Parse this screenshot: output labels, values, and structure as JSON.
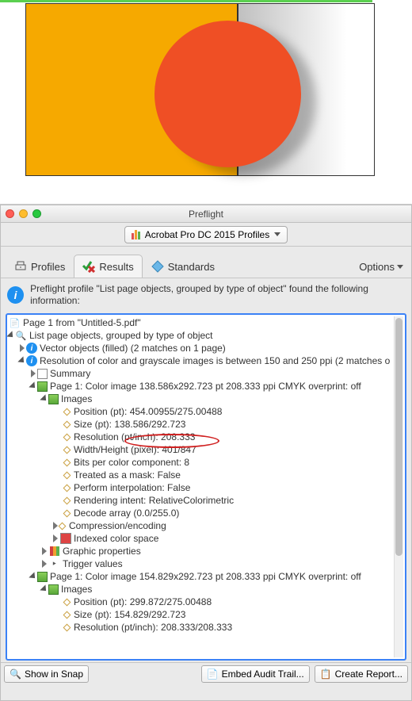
{
  "preview": {},
  "window": {
    "title": "Preflight"
  },
  "profile_dropdown": "Acrobat Pro DC 2015 Profiles",
  "tabs": {
    "profiles": "Profiles",
    "results": "Results",
    "standards": "Standards",
    "options": "Options"
  },
  "summary_text": "Preflight profile \"List page objects, grouped by type of object\" found the following information:",
  "tree": {
    "page_from": "Page 1 from \"Untitled-5.pdf\"",
    "list_header": "List page objects, grouped by type of object",
    "vector": "Vector objects (filled) (2 matches on 1 page)",
    "reso_header": "Resolution of color and grayscale images is between 150 and 250 ppi (2 matches o",
    "summary": "Summary",
    "page1a": "Page 1: Color image 138.586x292.723 pt 208.333 ppi CMYK  overprint: off",
    "images": "Images",
    "position_a": "Position (pt): 454.00955/275.00488",
    "size_a": "Size (pt): 138.586/292.723",
    "resolution_a": "Resolution (pt/inch): 208.333",
    "wh_a": "Width/Height (pixel): 401/847",
    "bpc": "Bits per color component: 8",
    "mask": "Treated as a mask: False",
    "interp": "Perform interpolation: False",
    "rendering": "Rendering intent: RelativeColorimetric",
    "decode": "Decode array (0.0/255.0)",
    "compression": "Compression/encoding",
    "indexed": "Indexed color space",
    "graphic": "Graphic properties",
    "trigger": "Trigger values",
    "page1b": "Page 1: Color image 154.829x292.723 pt 208.333 ppi CMYK  overprint: off",
    "position_b": "Position (pt): 299.872/275.00488",
    "size_b": "Size (pt): 154.829/292.723",
    "resolution_b": "Resolution (pt/inch): 208.333/208.333"
  },
  "footer": {
    "show_snap": "Show in Snap",
    "embed": "Embed Audit Trail...",
    "create": "Create Report..."
  }
}
